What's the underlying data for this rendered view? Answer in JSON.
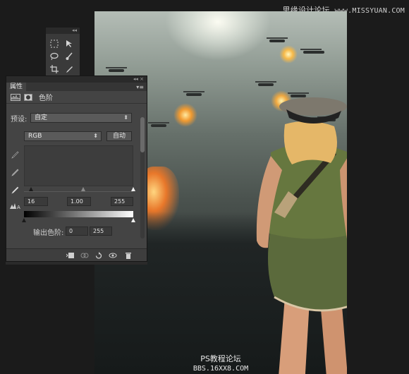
{
  "watermark": {
    "site_name": "思缘设计论坛",
    "site_url": "www.MISSYUAN.COM"
  },
  "tools_panel": {
    "collapse_label": "◂◂"
  },
  "properties_panel": {
    "tab_label": "属性",
    "collapse_label": "◂◂ ×",
    "adjustment_title": "色阶",
    "preset_label": "预设:",
    "preset_value": "自定",
    "channel_value": "RGB",
    "auto_button": "自动",
    "input_levels": {
      "black": "16",
      "gamma": "1.00",
      "white": "255"
    },
    "output_levels_label": "输出色阶:",
    "output_levels": {
      "black": "0",
      "white": "255"
    }
  },
  "canvas": {
    "caption_line1": "PS教程论坛",
    "caption_line2": "BBS.16XX8.COM"
  },
  "colors": {
    "panel_bg": "#444444",
    "panel_header": "#2a2a2a",
    "app_bg": "#1b1b1b"
  }
}
